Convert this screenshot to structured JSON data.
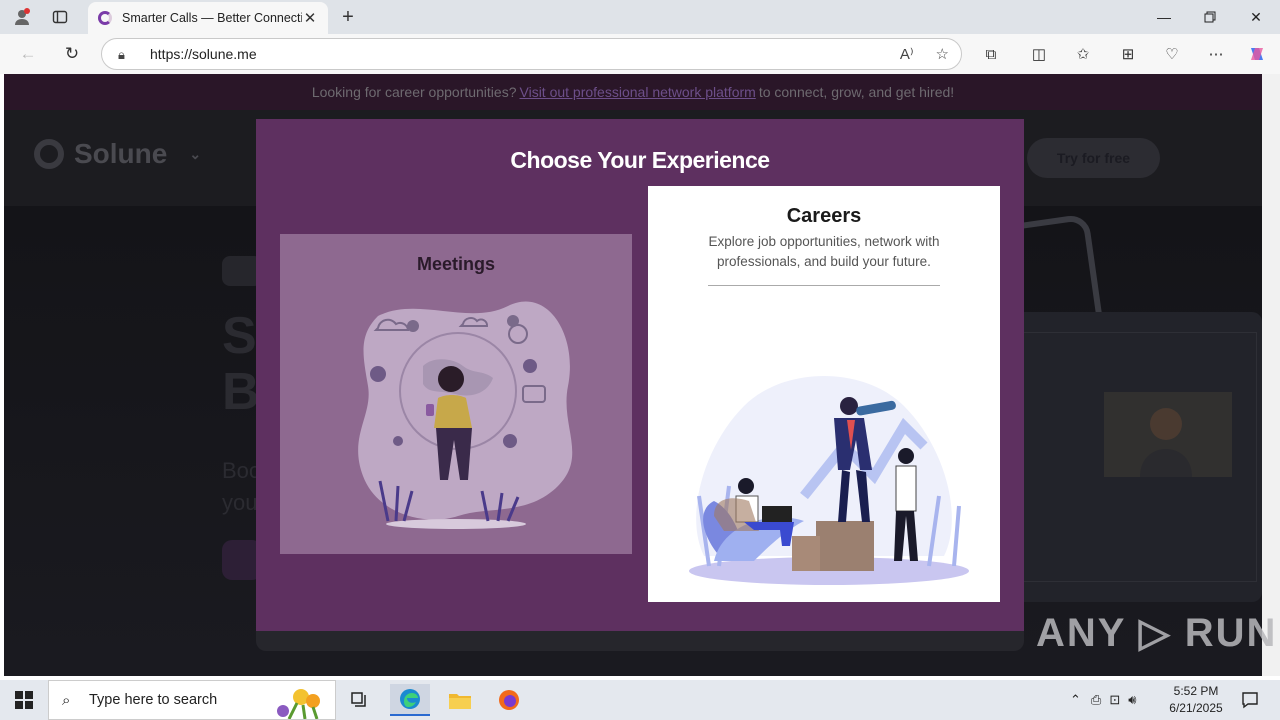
{
  "browser": {
    "tab_title": "Smarter Calls — Better Connectio",
    "url": "https://solune.me"
  },
  "site": {
    "banner_prefix": "Looking for career opportunities?",
    "banner_link": "Visit out professional network platform",
    "banner_suffix": "to connect, grow, and get hired!",
    "logo": "Solune",
    "try_label": "Try for free",
    "hero_line1": "S",
    "hero_line2": "B",
    "hero_sub1": "Boo",
    "hero_sub2": "you"
  },
  "modal": {
    "title": "Choose Your Experience",
    "meetings_label": "Meetings",
    "careers_label": "Careers",
    "careers_desc": "Explore job opportunities, network with professionals, and build your future."
  },
  "watermark": "ANY ▷ RUN",
  "taskbar": {
    "search_placeholder": "Type here to search",
    "time": "5:52 PM",
    "date": "6/21/2025"
  }
}
